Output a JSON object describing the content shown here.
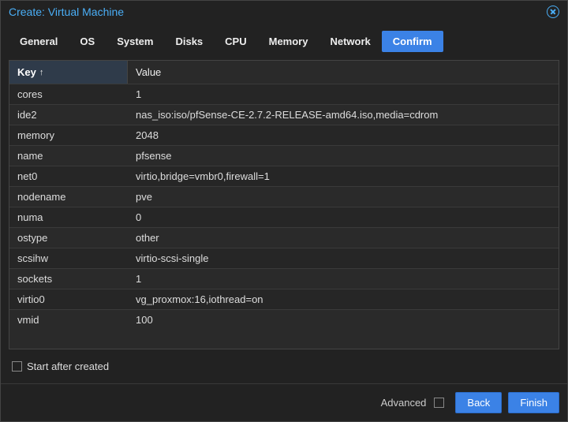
{
  "dialog": {
    "title": "Create: Virtual Machine"
  },
  "tabs": [
    {
      "label": "General"
    },
    {
      "label": "OS"
    },
    {
      "label": "System"
    },
    {
      "label": "Disks"
    },
    {
      "label": "CPU"
    },
    {
      "label": "Memory"
    },
    {
      "label": "Network"
    },
    {
      "label": "Confirm"
    }
  ],
  "active_tab_index": 7,
  "grid": {
    "headers": {
      "key": "Key",
      "value": "Value"
    },
    "sort_column": "key",
    "sort_direction": "asc",
    "rows": [
      {
        "key": "cores",
        "value": "1"
      },
      {
        "key": "ide2",
        "value": "nas_iso:iso/pfSense-CE-2.7.2-RELEASE-amd64.iso,media=cdrom"
      },
      {
        "key": "memory",
        "value": "2048"
      },
      {
        "key": "name",
        "value": "pfsense"
      },
      {
        "key": "net0",
        "value": "virtio,bridge=vmbr0,firewall=1"
      },
      {
        "key": "nodename",
        "value": "pve"
      },
      {
        "key": "numa",
        "value": "0"
      },
      {
        "key": "ostype",
        "value": "other"
      },
      {
        "key": "scsihw",
        "value": "virtio-scsi-single"
      },
      {
        "key": "sockets",
        "value": "1"
      },
      {
        "key": "virtio0",
        "value": "vg_proxmox:16,iothread=on"
      },
      {
        "key": "vmid",
        "value": "100"
      }
    ]
  },
  "start_after_created": {
    "label": "Start after created",
    "checked": false
  },
  "footer": {
    "advanced_label": "Advanced",
    "advanced_checked": false,
    "back_label": "Back",
    "finish_label": "Finish"
  }
}
